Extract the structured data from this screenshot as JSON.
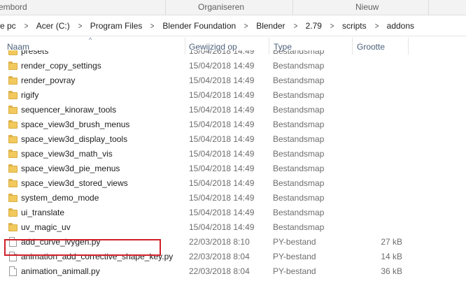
{
  "ribbon": {
    "groups": [
      "embord",
      "Organiseren",
      "Nieuw"
    ]
  },
  "address": {
    "crumbs": [
      "e pc",
      "Acer (C:)",
      "Program Files",
      "Blender Foundation",
      "Blender",
      "2.79",
      "scripts",
      "addons"
    ],
    "separator": ">"
  },
  "columns": {
    "name": "Naam",
    "date": "Gewijzigd op",
    "type": "Type",
    "size": "Grootte"
  },
  "files": [
    {
      "name": "presets",
      "date": "15/04/2018 14:49",
      "type": "Bestandsmap",
      "size": "",
      "kind": "folder"
    },
    {
      "name": "render_copy_settings",
      "date": "15/04/2018 14:49",
      "type": "Bestandsmap",
      "size": "",
      "kind": "folder"
    },
    {
      "name": "render_povray",
      "date": "15/04/2018 14:49",
      "type": "Bestandsmap",
      "size": "",
      "kind": "folder"
    },
    {
      "name": "rigify",
      "date": "15/04/2018 14:49",
      "type": "Bestandsmap",
      "size": "",
      "kind": "folder"
    },
    {
      "name": "sequencer_kinoraw_tools",
      "date": "15/04/2018 14:49",
      "type": "Bestandsmap",
      "size": "",
      "kind": "folder"
    },
    {
      "name": "space_view3d_brush_menus",
      "date": "15/04/2018 14:49",
      "type": "Bestandsmap",
      "size": "",
      "kind": "folder"
    },
    {
      "name": "space_view3d_display_tools",
      "date": "15/04/2018 14:49",
      "type": "Bestandsmap",
      "size": "",
      "kind": "folder"
    },
    {
      "name": "space_view3d_math_vis",
      "date": "15/04/2018 14:49",
      "type": "Bestandsmap",
      "size": "",
      "kind": "folder"
    },
    {
      "name": "space_view3d_pie_menus",
      "date": "15/04/2018 14:49",
      "type": "Bestandsmap",
      "size": "",
      "kind": "folder"
    },
    {
      "name": "space_view3d_stored_views",
      "date": "15/04/2018 14:49",
      "type": "Bestandsmap",
      "size": "",
      "kind": "folder"
    },
    {
      "name": "system_demo_mode",
      "date": "15/04/2018 14:49",
      "type": "Bestandsmap",
      "size": "",
      "kind": "folder"
    },
    {
      "name": "ui_translate",
      "date": "15/04/2018 14:49",
      "type": "Bestandsmap",
      "size": "",
      "kind": "folder"
    },
    {
      "name": "uv_magic_uv",
      "date": "15/04/2018 14:49",
      "type": "Bestandsmap",
      "size": "",
      "kind": "folder"
    },
    {
      "name": "add_curve_ivygen.py",
      "date": "22/03/2018 8:10",
      "type": "PY-bestand",
      "size": "27 kB",
      "kind": "file"
    },
    {
      "name": "animation_add_corrective_shape_key.py",
      "date": "22/03/2018 8:04",
      "type": "PY-bestand",
      "size": "14 kB",
      "kind": "file"
    },
    {
      "name": "animation_animall.py",
      "date": "22/03/2018 8:04",
      "type": "PY-bestand",
      "size": "36 kB",
      "kind": "file"
    }
  ],
  "highlight": {
    "target": "add_curve_ivygen.py",
    "color": "#d0202a"
  },
  "colors": {
    "folder": "#f2c95c",
    "header_text": "#4c607a",
    "secondary_text": "#6d6d6d"
  }
}
